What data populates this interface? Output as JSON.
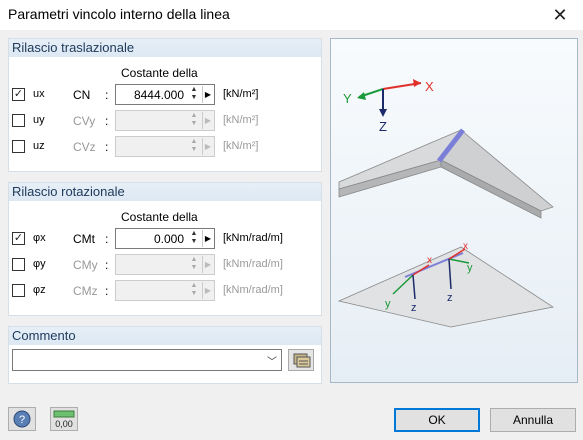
{
  "window": {
    "title": "Parametri vincolo interno della linea"
  },
  "translational": {
    "header": "Rilascio traslazionale",
    "subheader": "Costante della",
    "rows": [
      {
        "checked": true,
        "check_glyph": "✓",
        "symbol": "ux",
        "constant": "CN",
        "value": "8444.000",
        "unit": "[kN/m²]",
        "enabled": true
      },
      {
        "checked": false,
        "check_glyph": "",
        "symbol": "uy",
        "constant": "CVy",
        "value": "",
        "unit": "[kN/m²]",
        "enabled": false
      },
      {
        "checked": false,
        "check_glyph": "",
        "symbol": "uz",
        "constant": "CVz",
        "value": "",
        "unit": "[kN/m²]",
        "enabled": false
      }
    ]
  },
  "rotational": {
    "header": "Rilascio rotazionale",
    "subheader": "Costante della",
    "rows": [
      {
        "checked": true,
        "check_glyph": "✓",
        "symbol": "φx",
        "constant": "CMt",
        "value": "0.000",
        "unit": "[kNm/rad/m]",
        "enabled": true
      },
      {
        "checked": false,
        "check_glyph": "",
        "symbol": "φy",
        "constant": "CMy",
        "value": "",
        "unit": "[kNm/rad/m]",
        "enabled": false
      },
      {
        "checked": false,
        "check_glyph": "",
        "symbol": "φz",
        "constant": "CMz",
        "value": "",
        "unit": "[kNm/rad/m]",
        "enabled": false
      }
    ]
  },
  "comment": {
    "header": "Commento",
    "value": ""
  },
  "preview": {
    "axis_x": "X",
    "axis_y": "Y",
    "axis_z": "Z",
    "local_x": "x",
    "local_y": "y",
    "local_z": "z"
  },
  "buttons": {
    "ok": "OK",
    "cancel": "Annulla"
  },
  "icons": {
    "help": "help-icon",
    "units": "units-decimal-icon",
    "library": "comment-library-icon",
    "close": "close-icon"
  },
  "colors": {
    "accent": "#0078d7",
    "group_header": "#1e395b",
    "x_axis": "#e0302c",
    "y_axis": "#1a9a3a",
    "z_axis": "#1a2a6a",
    "hinge": "#7b7fd8"
  }
}
